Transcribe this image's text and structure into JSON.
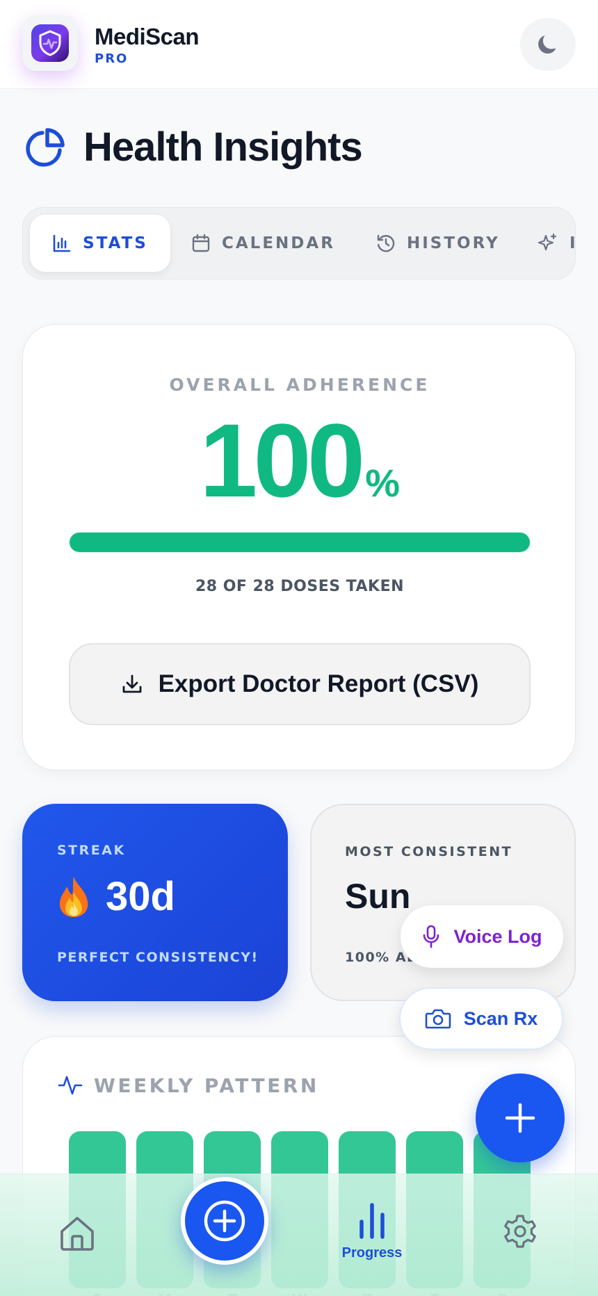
{
  "app": {
    "name": "MediScan",
    "tier": "PRO"
  },
  "page": {
    "title": "Health Insights"
  },
  "tabs": [
    {
      "label": "STATS",
      "icon": "bar-chart-icon",
      "active": true
    },
    {
      "label": "CALENDAR",
      "icon": "calendar-icon",
      "active": false
    },
    {
      "label": "HISTORY",
      "icon": "history-icon",
      "active": false
    },
    {
      "label": "I",
      "icon": "sparkles-icon",
      "active": false
    }
  ],
  "adherence": {
    "label": "OVERALL ADHERENCE",
    "value": "100",
    "unit": "%",
    "progress_fraction": 1.0,
    "doses_text": "28 OF 28 DOSES TAKEN",
    "export_label": "Export Doctor Report (CSV)"
  },
  "streak": {
    "label": "STREAK",
    "value": "30d",
    "note": "PERFECT CONSISTENCY!"
  },
  "most_consistent": {
    "label": "MOST CONSISTENT",
    "value": "Sun",
    "note": "100% AD"
  },
  "weekly": {
    "title": "WEEKLY PATTERN",
    "days": [
      "S",
      "M",
      "T",
      "W",
      "T",
      "F",
      "S"
    ]
  },
  "actions": {
    "voice_label": "Voice Log",
    "scan_label": "Scan Rx"
  },
  "nav": {
    "progress_label": "Progress"
  },
  "colors": {
    "accent_blue": "#1d4ed8",
    "success_green": "#10b981",
    "voice_purple": "#7e22ce"
  }
}
